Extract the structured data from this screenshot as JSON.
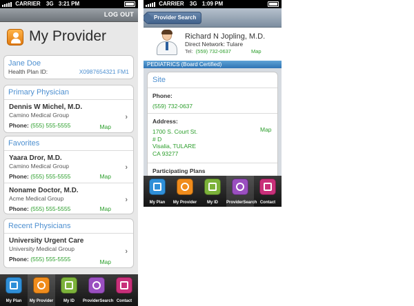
{
  "left_screen": {
    "status_bar": {
      "carrier": "CARRIER",
      "network": "3G",
      "time": "3:21 PM"
    },
    "top_bar": {
      "logout_label": "LOG OUT"
    },
    "page_title": "My Provider",
    "member": {
      "name": "Jane Doe",
      "plan_label": "Health Plan ID:",
      "plan_id": "X0987654321 FM1"
    },
    "primary_section": {
      "header": "Primary Physician",
      "items": [
        {
          "name": "Dennis W Michel, M.D.",
          "group": "Camino Medical Group",
          "phone_label": "Phone:",
          "phone": "(555) 555-5555",
          "map": "Map"
        }
      ]
    },
    "favorites_section": {
      "header": "Favorites",
      "items": [
        {
          "name": "Yaara Dror, M.D.",
          "group": "Camino Medical Group",
          "phone_label": "Phone:",
          "phone": "(555) 555-5555",
          "map": "Map"
        },
        {
          "name": "Noname Doctor, M.D.",
          "group": "Acme Medical Group",
          "phone_label": "Phone:",
          "phone": "(555) 555-5555",
          "map": "Map"
        }
      ]
    },
    "recent_section": {
      "header": "Recent Physicians",
      "items": [
        {
          "name": "University Urgent Care",
          "group": "University Medical Group",
          "phone_label": "Phone:",
          "phone": "(555) 555-5555",
          "map": "Map"
        }
      ]
    }
  },
  "right_screen": {
    "status_bar": {
      "carrier": "CARRIER",
      "network": "3G",
      "time": "1:09 PM"
    },
    "back_button": "Provider Search",
    "provider": {
      "name": "Richard N Jopling, M.D.",
      "network": "Direct Network: Tulare",
      "tel_label": "Tel:",
      "tel": "(559) 732-0637",
      "map": "Map"
    },
    "specialty": "PEDIATRICS (Board Certified)",
    "site": {
      "header": "Site",
      "phone_label": "Phone:",
      "phone": "(559) 732-0637",
      "address_label": "Address:",
      "address_line1": "1700 S. Court St.",
      "address_line2": "# D",
      "address_line3": "Visalia, TULARE",
      "address_line4": "CA 93277",
      "address_map": "Map",
      "participating_label": "Participating Plans"
    }
  },
  "tab_bar": {
    "tabs": [
      {
        "label": "My Plan",
        "icon": "my-plan-icon",
        "color": "#2f8fd8"
      },
      {
        "label": "My Provider",
        "icon": "my-provider-icon",
        "color": "#f08c1c"
      },
      {
        "label": "My ID",
        "icon": "my-id-icon",
        "color": "#7cb23a"
      },
      {
        "label": "ProviderSearch",
        "icon": "provider-search-icon",
        "color": "#9a4fc0"
      },
      {
        "label": "Contact",
        "icon": "contact-icon",
        "color": "#c9307a"
      }
    ]
  },
  "colors": {
    "link_blue": "#4d8fd0",
    "phone_green": "#2a9d2a",
    "specialty_blue": "#2f74b4"
  }
}
